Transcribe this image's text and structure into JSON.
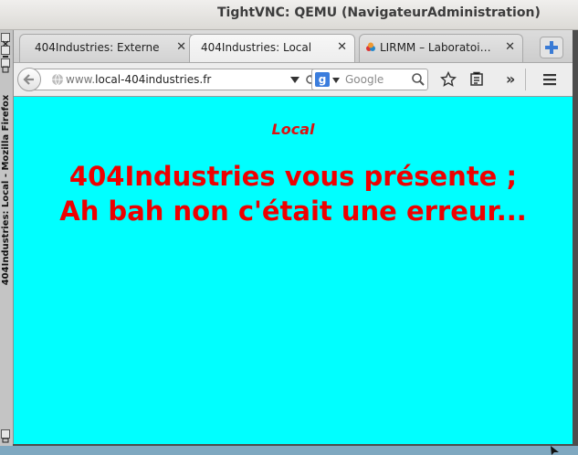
{
  "window": {
    "title": "TightVNC: QEMU (NavigateurAdministration)"
  },
  "firefox_window": {
    "side_title": "404Industries: Local - Mozilla Firefox"
  },
  "tabs": [
    {
      "label": "404Industries: Externe",
      "close": "✕",
      "active": false
    },
    {
      "label": "404Industries: Local",
      "close": "✕",
      "active": true
    },
    {
      "label": "LIRMM – Laboratoi…",
      "close": "✕",
      "active": false
    }
  ],
  "newtab": {
    "icon": "plus-icon"
  },
  "navbar": {
    "url_host_dim": "www.",
    "url_main": "local-404industries.fr",
    "search_engine_label": "g",
    "search_placeholder": "Google",
    "overflow": "»"
  },
  "page": {
    "subtitle": "Local",
    "heading_line1": "404Industries vous présente ;",
    "heading_line2": "Ah bah non c'était une erreur..."
  },
  "colors": {
    "page_background": "#00ffff",
    "text_red": "#ee0000",
    "subtitle_red": "#dd1111"
  }
}
